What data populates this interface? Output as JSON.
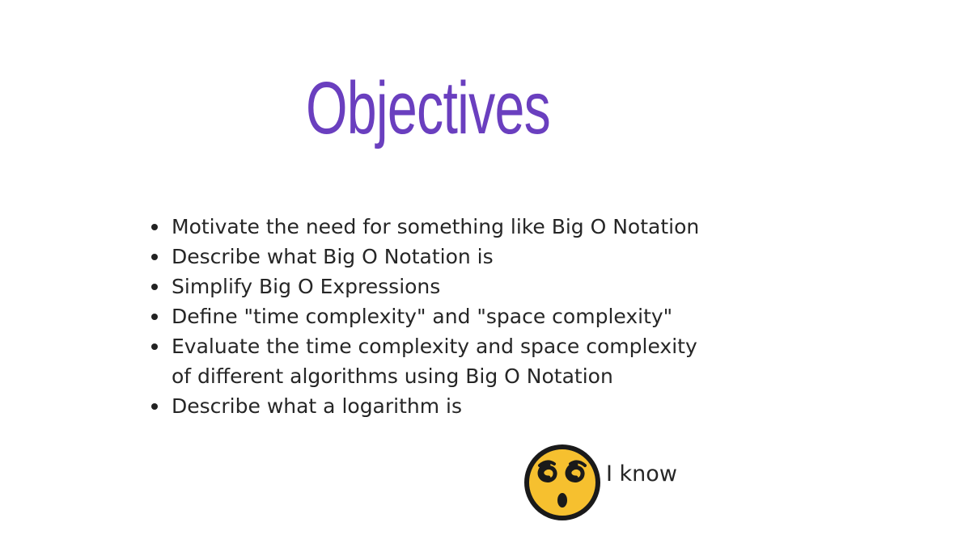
{
  "slide": {
    "title": "Objectives",
    "objectives": [
      "Motivate the need for something like Big O Notation",
      "Describe what Big O Notation is",
      "Simplify Big O Expressions",
      "Define \"time complexity\" and \"space complexity\"",
      "Evaluate the time complexity and space complexity\nof different algorithms using Big O Notation",
      "Describe what a logarithm is"
    ],
    "reaction": {
      "icon": "dizzy-face-emoji-icon",
      "text": "I know"
    }
  },
  "colors": {
    "title": "#6a3fbf",
    "body_text": "#262626",
    "emoji_face": "#f6c02f",
    "emoji_outline": "#1a1a1a"
  }
}
